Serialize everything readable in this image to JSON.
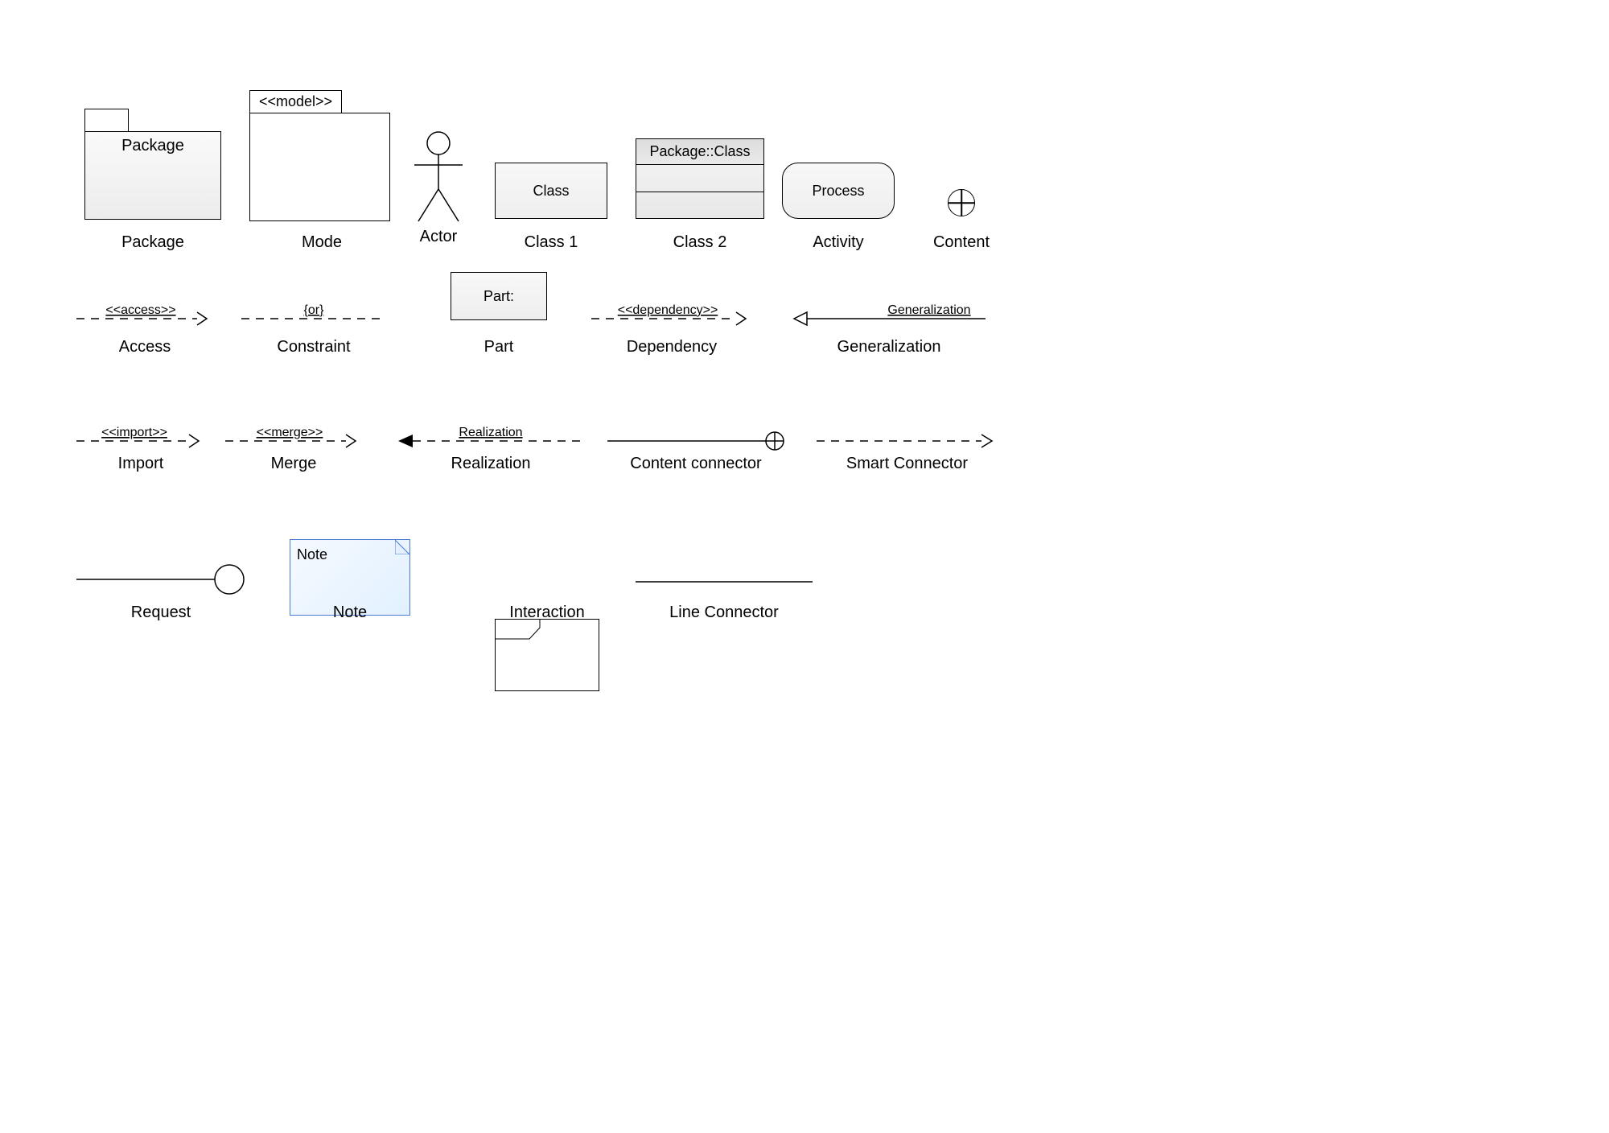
{
  "row1": {
    "package": {
      "label": "Package",
      "caption": "Package"
    },
    "mode": {
      "stereo": "<<model>>",
      "caption": "Mode"
    },
    "actor": {
      "caption": "Actor"
    },
    "class1": {
      "label": "Class",
      "caption": "Class 1"
    },
    "class2": {
      "head": "Package::Class",
      "caption": "Class 2"
    },
    "activity": {
      "label": "Process",
      "caption": "Activity"
    },
    "content": {
      "caption": "Content"
    }
  },
  "row2": {
    "access": {
      "lbl": "<<access>>",
      "caption": "Access"
    },
    "constraint": {
      "lbl": "{or}",
      "caption": "Constraint"
    },
    "part": {
      "label": "Part:",
      "caption": "Part"
    },
    "dependency": {
      "lbl": "<<dependency>>",
      "caption": "Dependency"
    },
    "generalization": {
      "lbl": "Generalization",
      "caption": "Generalization"
    }
  },
  "row3": {
    "import": {
      "lbl": "<<import>>",
      "caption": "Import"
    },
    "merge": {
      "lbl": "<<merge>>",
      "caption": "Merge"
    },
    "realization": {
      "lbl": "Realization",
      "caption": "Realization"
    },
    "contentconn": {
      "caption": "Content connector"
    },
    "smart": {
      "caption": "Smart Connector"
    }
  },
  "row4": {
    "request": {
      "caption": "Request"
    },
    "note": {
      "label": "Note",
      "caption": "Note"
    },
    "interaction": {
      "caption": "Interaction"
    },
    "lineconn": {
      "caption": "Line Connector"
    }
  }
}
